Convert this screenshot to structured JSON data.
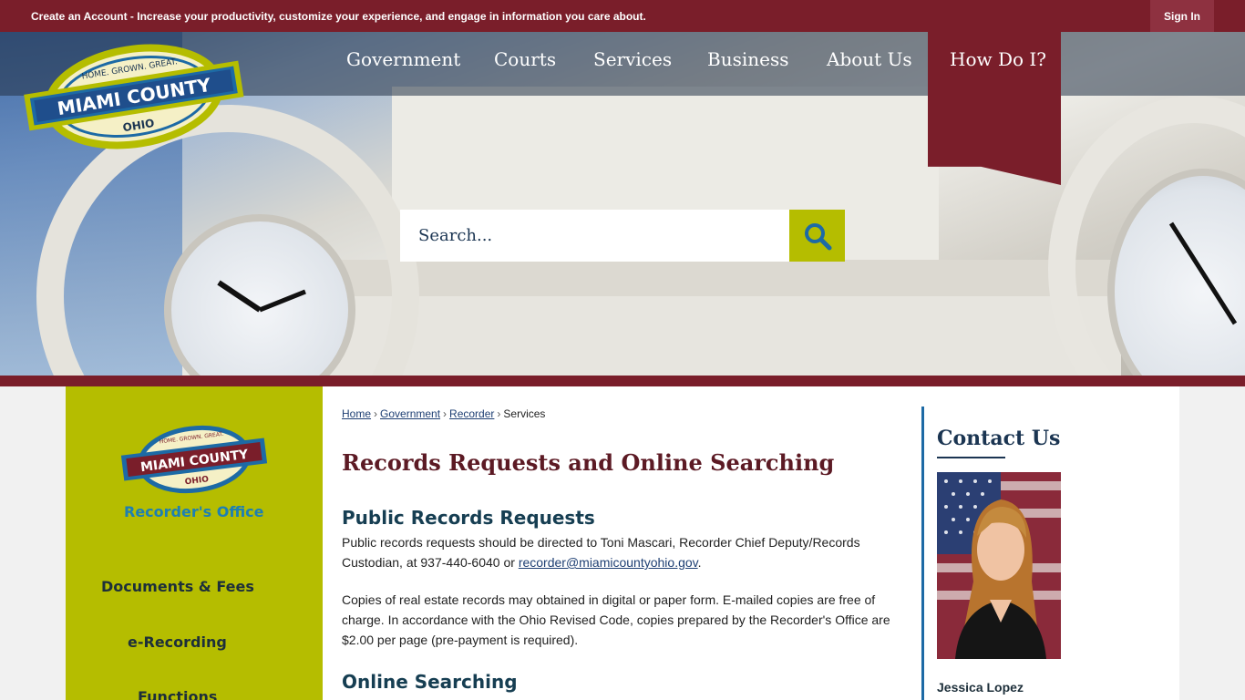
{
  "topbar": {
    "create_account_label": "Create an Account",
    "create_account_msg": " - Increase your productivity, customize your experience, and engage in information you care about.",
    "sign_in_label": "Sign In"
  },
  "logo": {
    "tagline": "HOME. GROWN. GREAT.",
    "name": "MIAMI COUNTY",
    "state": "OHIO"
  },
  "nav": {
    "items": [
      "Government",
      "Courts",
      "Services",
      "Business",
      "About Us"
    ],
    "how_do_i": "How Do I?"
  },
  "search": {
    "placeholder": "Search..."
  },
  "sidebar": {
    "caption": "Recorder's Office",
    "items": [
      "Documents & Fees",
      "e-Recording",
      "Functions"
    ]
  },
  "breadcrumb": {
    "home": "Home",
    "government": "Government",
    "recorder": "Recorder",
    "current": "Services"
  },
  "main": {
    "title": "Records Requests and Online Searching",
    "section1_heading": "Public Records Requests",
    "section1_text": "Public records requests should be directed to Toni Mascari, Recorder Chief Deputy/Records Custodian, at 937-440-6040 or ",
    "section1_email": "recorder@miamicountyohio.gov",
    "section1_end": ".",
    "section2_text": "Copies of real estate records may obtained in digital or paper form.  E-mailed copies are free of charge. In accordance with the Ohio Revised Code, copies prepared by the Recorder's Office are $2.00 per page (pre-payment is required).",
    "section2_heading": "Online Searching"
  },
  "contact": {
    "title": "Contact Us",
    "name": "Jessica Lopez"
  },
  "colors": {
    "maroon": "#7a1e2a",
    "lime": "#b5bd00",
    "navy": "#1b3552"
  }
}
